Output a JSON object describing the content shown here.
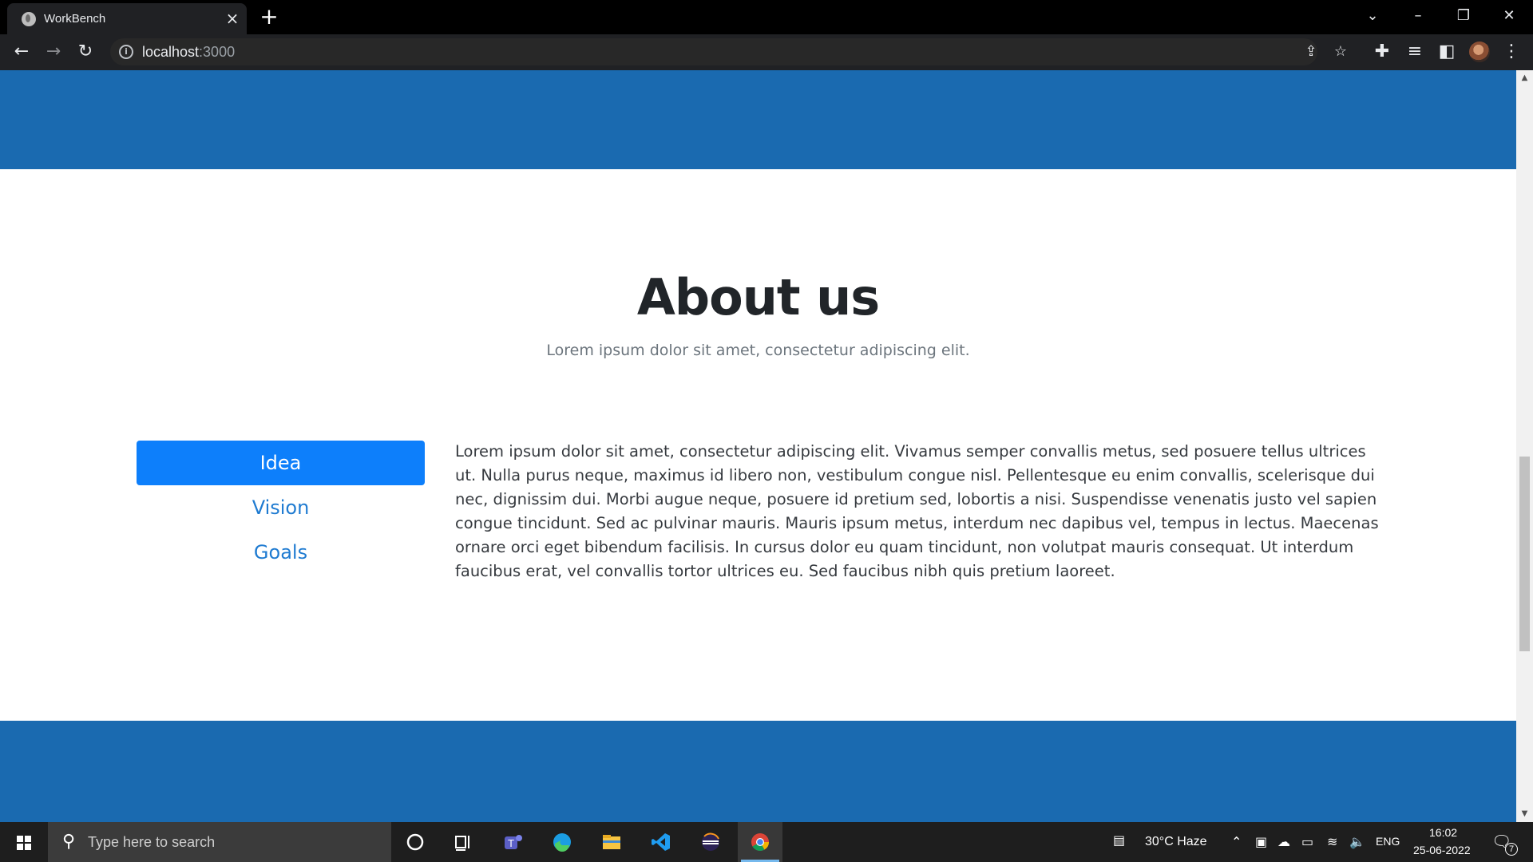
{
  "browser": {
    "tab_title": "WorkBench",
    "url_host": "localhost",
    "url_port": ":3000"
  },
  "page": {
    "about": {
      "title": "About us",
      "subtitle": "Lorem ipsum dolor sit amet, consectetur adipiscing elit.",
      "tabs": [
        {
          "label": "Idea",
          "active": true
        },
        {
          "label": "Vision",
          "active": false
        },
        {
          "label": "Goals",
          "active": false
        }
      ],
      "body": "Lorem ipsum dolor sit amet, consectetur adipiscing elit. Vivamus semper convallis metus, sed posuere tellus ultrices ut. Nulla purus neque, maximus id libero non, vestibulum congue nisl. Pellentesque eu enim convallis, scelerisque dui nec, dignissim dui. Morbi augue neque, posuere id pretium sed, lobortis a nisi. Suspendisse venenatis justo vel sapien congue tincidunt. Sed ac pulvinar mauris. Mauris ipsum metus, interdum nec dapibus vel, tempus in lectus. Maecenas ornare orci eget bibendum facilisis. In cursus dolor eu quam tincidunt, non volutpat mauris consequat. Ut interdum faucibus erat, vel convallis tortor ultrices eu. Sed faucibus nibh quis pretium laoreet."
    },
    "colors": {
      "band": "#1a6ab0",
      "active_tab": "#0d7ffb",
      "link": "#1f7bd1"
    }
  },
  "taskbar": {
    "search_placeholder": "Type here to search",
    "weather": "30°C  Haze",
    "language": "ENG",
    "time": "16:02",
    "date": "25-06-2022",
    "notification_count": "7"
  }
}
